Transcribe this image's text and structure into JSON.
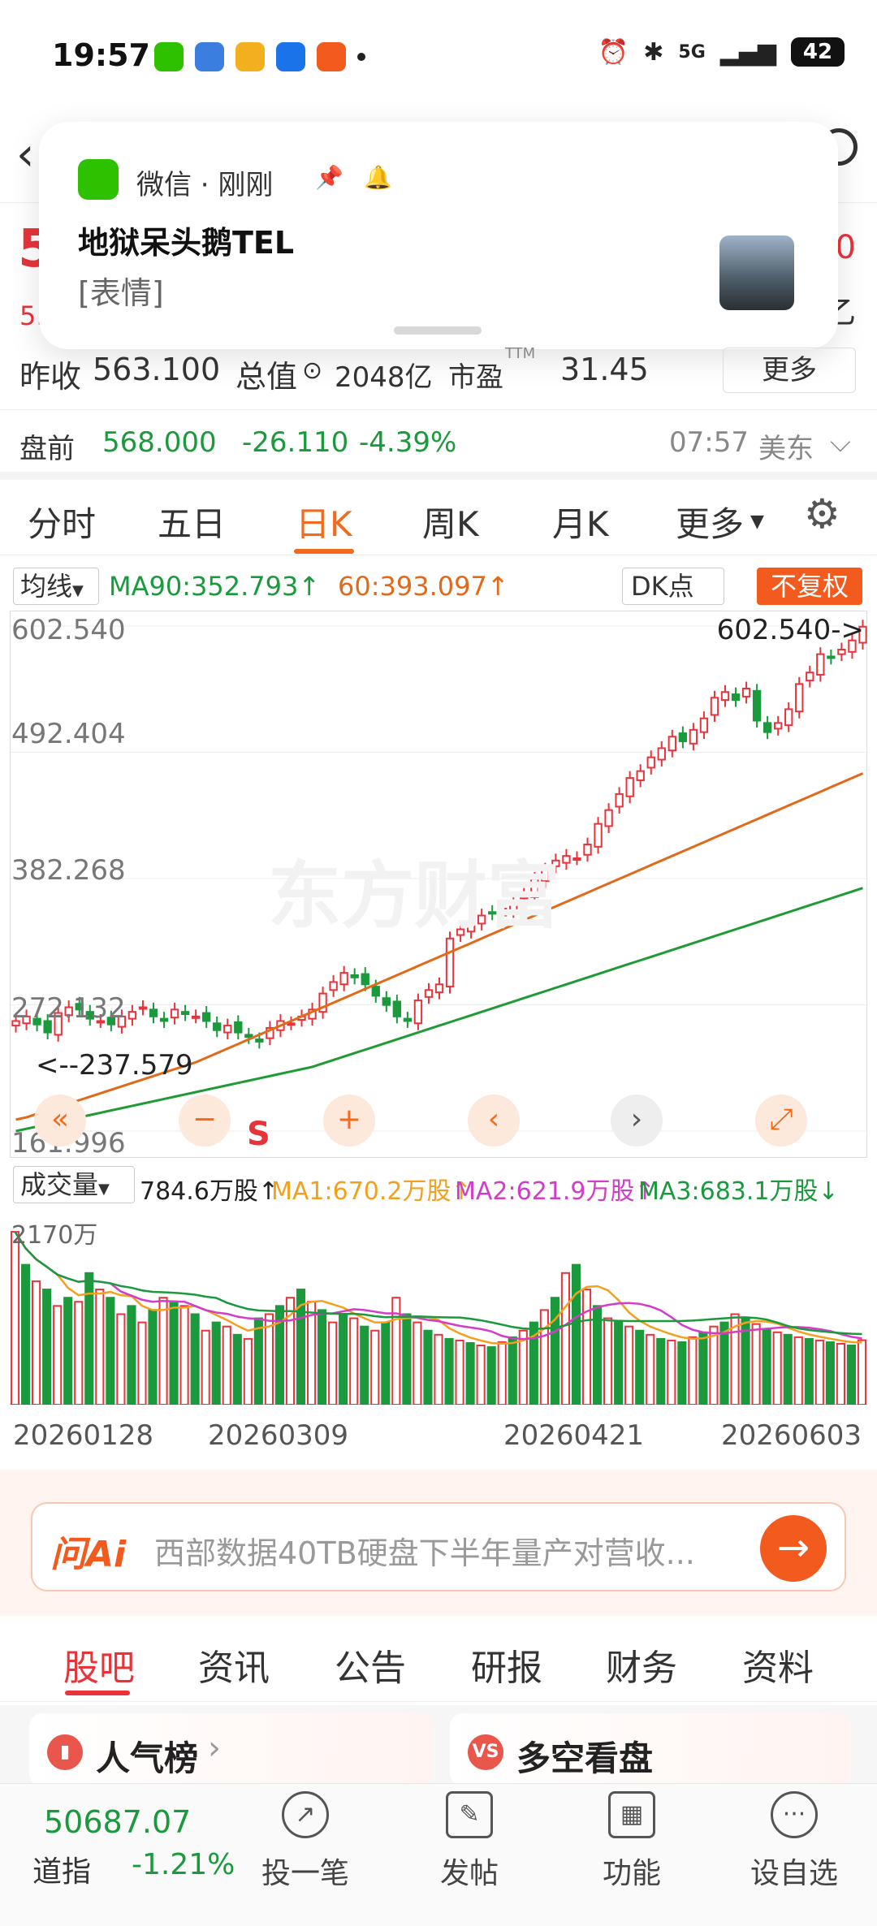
{
  "status_bar": {
    "time": "19:57",
    "battery": "42",
    "net": "5G"
  },
  "notification": {
    "app": "微信 · 刚刚",
    "title": "地狱呆头鹅TEL",
    "body": "[表情]"
  },
  "header": {
    "price_partial": "5",
    "sub_partial": "5.",
    "right_partial_1": "0",
    "right_partial_2": "乙"
  },
  "info": {
    "prev_close_label": "昨收",
    "prev_close": "563.100",
    "mktcap_label": "总值",
    "mktcap": "2048亿",
    "pe_label": "市盈",
    "pe_sup": "TTM",
    "pe": "31.45",
    "more_label": "更多"
  },
  "premarket": {
    "label": "盘前",
    "price": "568.000",
    "change": "-26.110",
    "pct": "-4.39%",
    "time": "07:57",
    "market": "美东"
  },
  "tabs": [
    {
      "label": "分时"
    },
    {
      "label": "五日"
    },
    {
      "label": "日K"
    },
    {
      "label": "周K"
    },
    {
      "label": "月K"
    },
    {
      "label": "更多"
    }
  ],
  "ma": {
    "select_label": "均线",
    "ma90": "MA90:352.793↑",
    "ma60": "60:393.097↑",
    "dk_label": "DK点",
    "fq_label": "不复权"
  },
  "chart_axis": {
    "p1": "602.540",
    "p2": "492.404",
    "p3": "382.268",
    "p4": "272.132",
    "p5": "161.996",
    "max_marker": "602.540->",
    "min_marker": "<--237.579",
    "watermark": "东方财富"
  },
  "volume": {
    "select_label": "成交量",
    "vol": "784.6万股↑",
    "ma1": "MA1:670.2万股↑",
    "ma2": "MA2:621.9万股↑",
    "ma3": "MA3:683.1万股↓",
    "axis_top": "2170万"
  },
  "dates": [
    "20260128",
    "20260309",
    "20260421",
    "20260603"
  ],
  "ai": {
    "logo": "问Ai",
    "text": "西部数据40TB硬盘下半年量产对营收..."
  },
  "sub_tabs": [
    {
      "label": "股吧"
    },
    {
      "label": "资讯"
    },
    {
      "label": "公告"
    },
    {
      "label": "研报"
    },
    {
      "label": "财务"
    },
    {
      "label": "资料"
    }
  ],
  "cards": {
    "left": "人气榜",
    "right": "多空看盘",
    "right_icon": "VS"
  },
  "bottom_nav": {
    "dji_value": "50687.07",
    "dji_name": "道指",
    "dji_pct": "-1.21%",
    "items": [
      {
        "label": "投一笔",
        "icon": "trend-icon"
      },
      {
        "label": "发帖",
        "icon": "edit-icon"
      },
      {
        "label": "功能",
        "icon": "grid-icon"
      },
      {
        "label": "设自选",
        "icon": "more-icon"
      }
    ]
  },
  "colors": {
    "up": "#e8333a",
    "down": "#1a9a3c",
    "accent": "#f26b1d",
    "ma60": "#e06a1a",
    "ma90": "#1f9a35"
  },
  "chart_data": {
    "type": "candlestick",
    "y_range": [
      161.996,
      602.54
    ],
    "y_ticks": [
      602.54,
      492.404,
      382.268,
      272.132,
      161.996
    ],
    "max": 602.54,
    "min": 237.579,
    "close_series": [
      258,
      262,
      255,
      248,
      265,
      270,
      268,
      260,
      258,
      255,
      262,
      266,
      270,
      262,
      258,
      268,
      264,
      262,
      258,
      250,
      254,
      248,
      244,
      240,
      252,
      258,
      256,
      262,
      268,
      282,
      292,
      300,
      296,
      290,
      280,
      272,
      262,
      258,
      276,
      285,
      290,
      330,
      338,
      345,
      350,
      352,
      356,
      362,
      368,
      382,
      390,
      398,
      402,
      400,
      412,
      430,
      442,
      456,
      470,
      476,
      488,
      496,
      506,
      502,
      512,
      522,
      540,
      545,
      538,
      548,
      520,
      510,
      518,
      530,
      552,
      562,
      578,
      575,
      582,
      590,
      602
    ],
    "ma60_series": [
      172,
      174,
      177,
      180,
      183,
      186,
      189,
      192,
      195,
      198,
      201,
      204,
      207,
      210,
      213,
      216,
      219,
      222,
      226,
      230,
      234,
      238,
      242,
      246,
      250,
      254,
      258,
      262,
      266,
      270,
      274,
      278,
      282,
      286,
      290,
      294,
      298,
      302,
      306,
      310,
      314,
      318,
      322,
      326,
      330,
      334,
      338,
      342,
      346,
      350,
      354,
      358,
      362,
      366,
      370,
      374,
      378,
      382,
      386,
      390,
      394,
      398,
      402,
      406,
      410,
      414,
      418,
      422,
      426,
      430,
      434,
      438,
      442,
      446,
      450,
      454,
      458,
      462,
      466,
      470,
      474
    ],
    "ma90_series": [
      162,
      164,
      166,
      168,
      170,
      172,
      174,
      176,
      178,
      180,
      182,
      184,
      186,
      188,
      190,
      192,
      194,
      196,
      198,
      200,
      202,
      204,
      206,
      208,
      210,
      212,
      214,
      216,
      218,
      221,
      224,
      227,
      230,
      233,
      236,
      239,
      242,
      245,
      248,
      251,
      254,
      257,
      260,
      263,
      266,
      269,
      272,
      275,
      278,
      281,
      284,
      287,
      290,
      293,
      296,
      299,
      302,
      305,
      308,
      311,
      314,
      317,
      320,
      323,
      326,
      329,
      332,
      335,
      338,
      341,
      344,
      347,
      350,
      353,
      356,
      359,
      362,
      365,
      368,
      371,
      374
    ],
    "volume_values": [
      2100,
      1700,
      1500,
      1400,
      1200,
      1300,
      1250,
      1600,
      1400,
      1300,
      1100,
      1200,
      1000,
      1150,
      1300,
      1250,
      1200,
      1100,
      900,
      1000,
      950,
      850,
      800,
      1050,
      1100,
      1200,
      1300,
      1400,
      1250,
      1150,
      1000,
      1100,
      1050,
      950,
      900,
      1000,
      1300,
      1100,
      1000,
      900,
      850,
      800,
      780,
      750,
      720,
      700,
      760,
      820,
      900,
      1000,
      1150,
      1300,
      1600,
      1700,
      1400,
      1200,
      1050,
      1000,
      950,
      900,
      850,
      800,
      780,
      760,
      820,
      880,
      950,
      1000,
      1100,
      1050,
      980,
      920,
      880,
      850,
      820,
      800,
      780,
      760,
      740,
      720,
      784
    ],
    "dates": [
      "20260128",
      "20260309",
      "20260421",
      "20260603"
    ]
  }
}
